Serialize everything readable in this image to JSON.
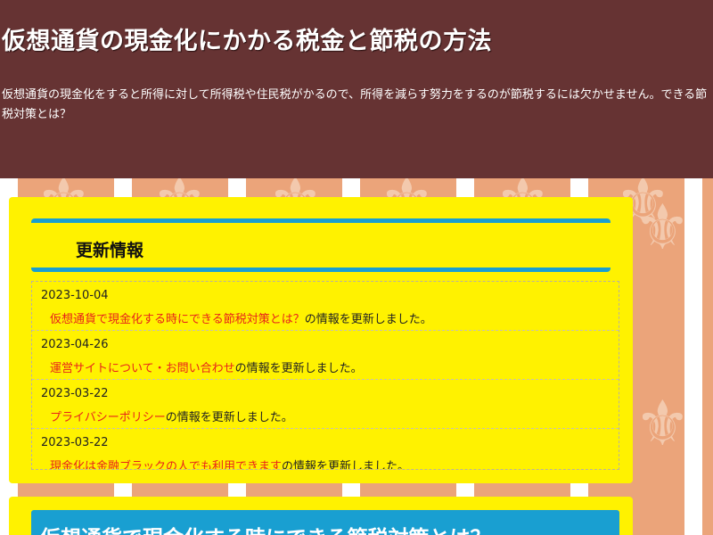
{
  "header": {
    "title": "仮想通貨の現金化にかかる税金と節税の方法",
    "description": "仮想通貨の現金化をすると所得に対して所得税や住民税がかるので、所得を減らす努力をするのが節税するには欠かせません。できる節税対策とは？"
  },
  "updates": {
    "heading": "更新情報",
    "suffix": "の情報を更新しました。",
    "items": [
      {
        "date": "2023-10-04",
        "link": "仮想通貨で現金化する時にできる節税対策とは？"
      },
      {
        "date": "2023-04-26",
        "link": "運営サイトについて・お問い合わせ"
      },
      {
        "date": "2023-03-22",
        "link": "プライバシーポリシー"
      },
      {
        "date": "2023-03-22",
        "link": "現金化は金融ブラックの人でも利用できます"
      }
    ]
  },
  "article": {
    "heading": "仮想通貨で現金化する時にできる節税対策とは？"
  },
  "colors": {
    "header_bg": "#663333",
    "panel_bg": "#fff200",
    "accent": "#199fd1",
    "link": "#e8231a"
  }
}
